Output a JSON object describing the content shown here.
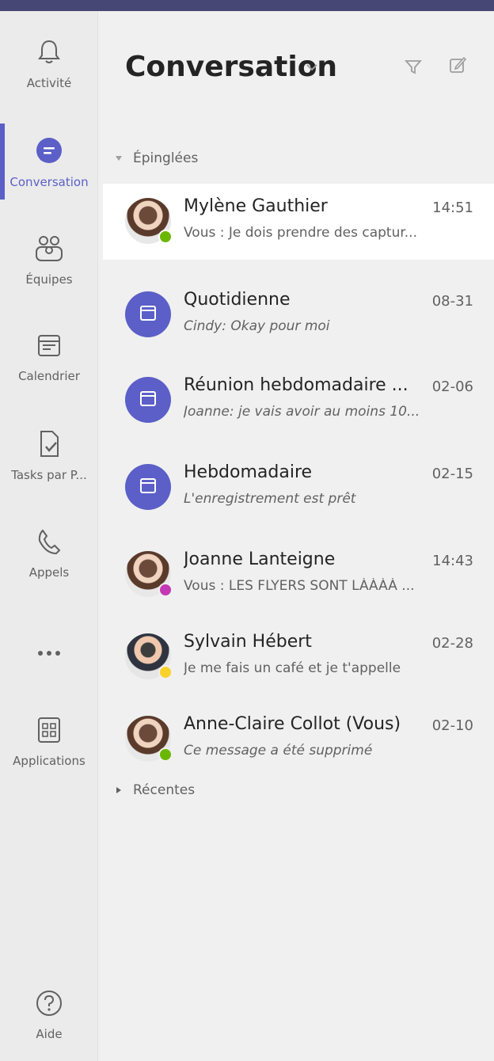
{
  "colors": {
    "accent": "#5b5fc7",
    "titlebar": "#464775",
    "presence_available": "#6bb700",
    "presence_away": "#f8d22a",
    "presence_oof": "#c239b3"
  },
  "rail": {
    "items": [
      {
        "label": "Activité",
        "icon": "bell-icon"
      },
      {
        "label": "Conversation",
        "icon": "chat-icon"
      },
      {
        "label": "Équipes",
        "icon": "teams-icon"
      },
      {
        "label": "Calendrier",
        "icon": "calendar-icon"
      },
      {
        "label": "Tasks par P...",
        "icon": "tasks-icon"
      },
      {
        "label": "Appels",
        "icon": "phone-icon"
      },
      {
        "label": "...",
        "icon": "more-icon"
      },
      {
        "label": "Applications",
        "icon": "apps-icon"
      }
    ],
    "help_label": "Aide"
  },
  "header": {
    "title": "Conversation"
  },
  "sections": {
    "pinned": "Épinglées",
    "recent": "Récentes"
  },
  "chats": [
    {
      "name": "Mylène Gauthier",
      "time": "14:51",
      "preview": "Vous : Je dois prendre des captur...",
      "presence": "available"
    },
    {
      "name": "Quotidienne",
      "time": "08-31",
      "preview": "Cindy: Okay pour moi",
      "presence": "none"
    },
    {
      "name": "Réunion hebdomadaire ...",
      "time": "02-06",
      "preview": "Joanne: je vais avoir au moins 10...",
      "presence": "none"
    },
    {
      "name": "Hebdomadaire",
      "time": "02-15",
      "preview": "L'enregistrement est prêt",
      "presence": "none"
    },
    {
      "name": "Joanne Lanteigne",
      "time": "14:43",
      "preview": "Vous : LES FLYERS SONT LÀÀÀÀ ...",
      "presence": "oof"
    },
    {
      "name": "Sylvain Hébert",
      "time": "02-28",
      "preview": "Je me fais un café et je t'appelle",
      "presence": "away"
    },
    {
      "name": "Anne-Claire Collot (Vous)",
      "time": "02-10",
      "preview": "Ce message a été supprimé",
      "presence": "available"
    }
  ]
}
